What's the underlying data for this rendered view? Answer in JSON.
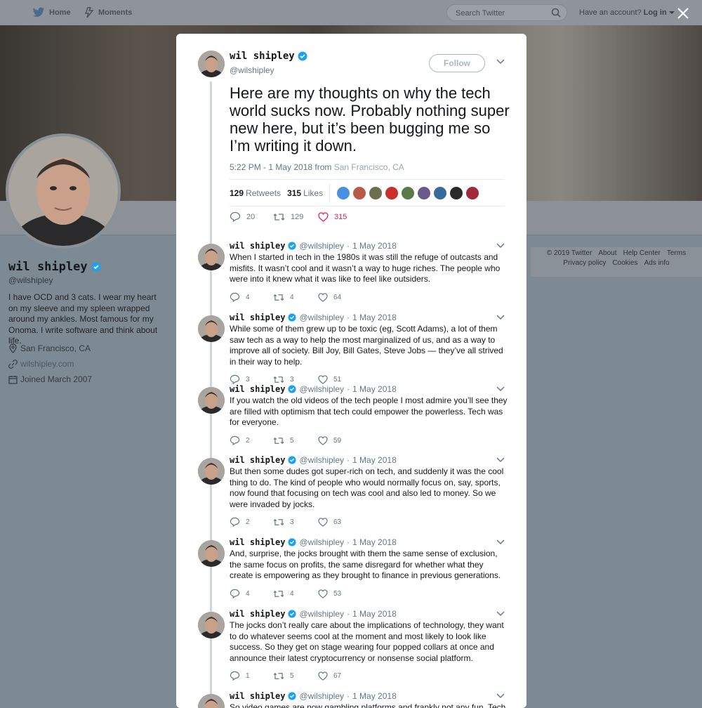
{
  "nav": {
    "home_label": "Home",
    "moments_label": "Moments",
    "search_placeholder": "Search Twitter",
    "account_prompt": "Have an account?",
    "login_label": "Log in"
  },
  "profile": {
    "name": "wil shipley",
    "handle": "@wilshipley",
    "bio": "I have OCD and 3 cats. I wear my heart on my sleeve and my spleen wrapped around my ankles. Most famous for my Onoma. I write software and think about life.",
    "location": "San Francisco, CA",
    "website": "wilshipley.com",
    "joined": "Joined March 2007"
  },
  "footer": {
    "row1": [
      "© 2019 Twitter",
      "About",
      "Help Center",
      "Terms"
    ],
    "row2": [
      "Privacy policy",
      "Cookies",
      "Ads info"
    ]
  },
  "main_tweet": {
    "name": "wil shipley",
    "handle": "@wilshipley",
    "follow_label": "Follow",
    "text": "Here are my thoughts on why the tech world sucks now. Probably nothing super new here, but it’s been bugging me so I’m writing it down.",
    "timestamp": "5:22 PM - 1 May 2018",
    "from_label": "from",
    "location": "San Francisco, CA",
    "retweets": "129",
    "retweets_label": "Retweets",
    "likes": "315",
    "likes_label": "Likes",
    "replies_count": "20",
    "retweet_count": "129",
    "like_count": "315",
    "liker_colors": [
      "#4a90e2",
      "#b85c4a",
      "#6b6f4e",
      "#c9302c",
      "#5a7a4a",
      "#6a5a8a",
      "#3a6a9a",
      "#2a2a2a",
      "#a02a3a"
    ]
  },
  "replies": [
    {
      "name": "wil shipley",
      "handle": "@wilshipley",
      "date": "1 May 2018",
      "text": "When I started in tech in the 1980s it was still the refuge of outcasts and misfits. It wasn’t cool and it wasn’t a way to huge riches. The people who were into it knew what it was like to feel like outsiders.",
      "replies": "4",
      "retweets": "4",
      "likes": "64"
    },
    {
      "name": "wil shipley",
      "handle": "@wilshipley",
      "date": "1 May 2018",
      "text": "While some of them grew up to be toxic (eg, Scott Adams), a lot of them saw tech as a way to help the most marginalized of us, and as a way to improve all of society. Bill Joy, Bill Gates, Steve Jobs — they’ve all strived in their way to help.",
      "replies": "3",
      "retweets": "3",
      "likes": "51"
    },
    {
      "name": "wil shipley",
      "handle": "@wilshipley",
      "date": "1 May 2018",
      "text": "If you watch the old videos of the tech people I most admire you’ll see they are filled with optimism that tech could empower the powerless. Tech was for everyone.",
      "replies": "2",
      "retweets": "5",
      "likes": "59"
    },
    {
      "name": "wil shipley",
      "handle": "@wilshipley",
      "date": "1 May 2018",
      "text": "But then some dudes got super-rich on tech, and suddenly it was the cool thing to do. The kind of people who would normally focus on, say, sports, now found that focusing on tech was cool and also led to money. So we were invaded by jocks.",
      "replies": "2",
      "retweets": "3",
      "likes": "63"
    },
    {
      "name": "wil shipley",
      "handle": "@wilshipley",
      "date": "1 May 2018",
      "text": "And, surprise, the jocks brought with them the same sense of exclusion, the same focus on profits, the same disregard for whether what they create is empowering as they brought to finance in previous generations.",
      "replies": "4",
      "retweets": "4",
      "likes": "53"
    },
    {
      "name": "wil shipley",
      "handle": "@wilshipley",
      "date": "1 May 2018",
      "text": "The jocks don’t really care about the implications of technology, they want to do whatever seems cool at the moment and most likely to look like success. So they get on stage wearing four popped collars at once and announce their latest cryptocurrency or nonsense social platform.",
      "replies": "1",
      "retweets": "5",
      "likes": "67"
    },
    {
      "name": "wil shipley",
      "handle": "@wilshipley",
      "date": "1 May 2018",
      "text": "So video games are now gambling platforms and frankly not any fun. Tech jocks",
      "replies": "",
      "retweets": "",
      "likes": ""
    }
  ]
}
